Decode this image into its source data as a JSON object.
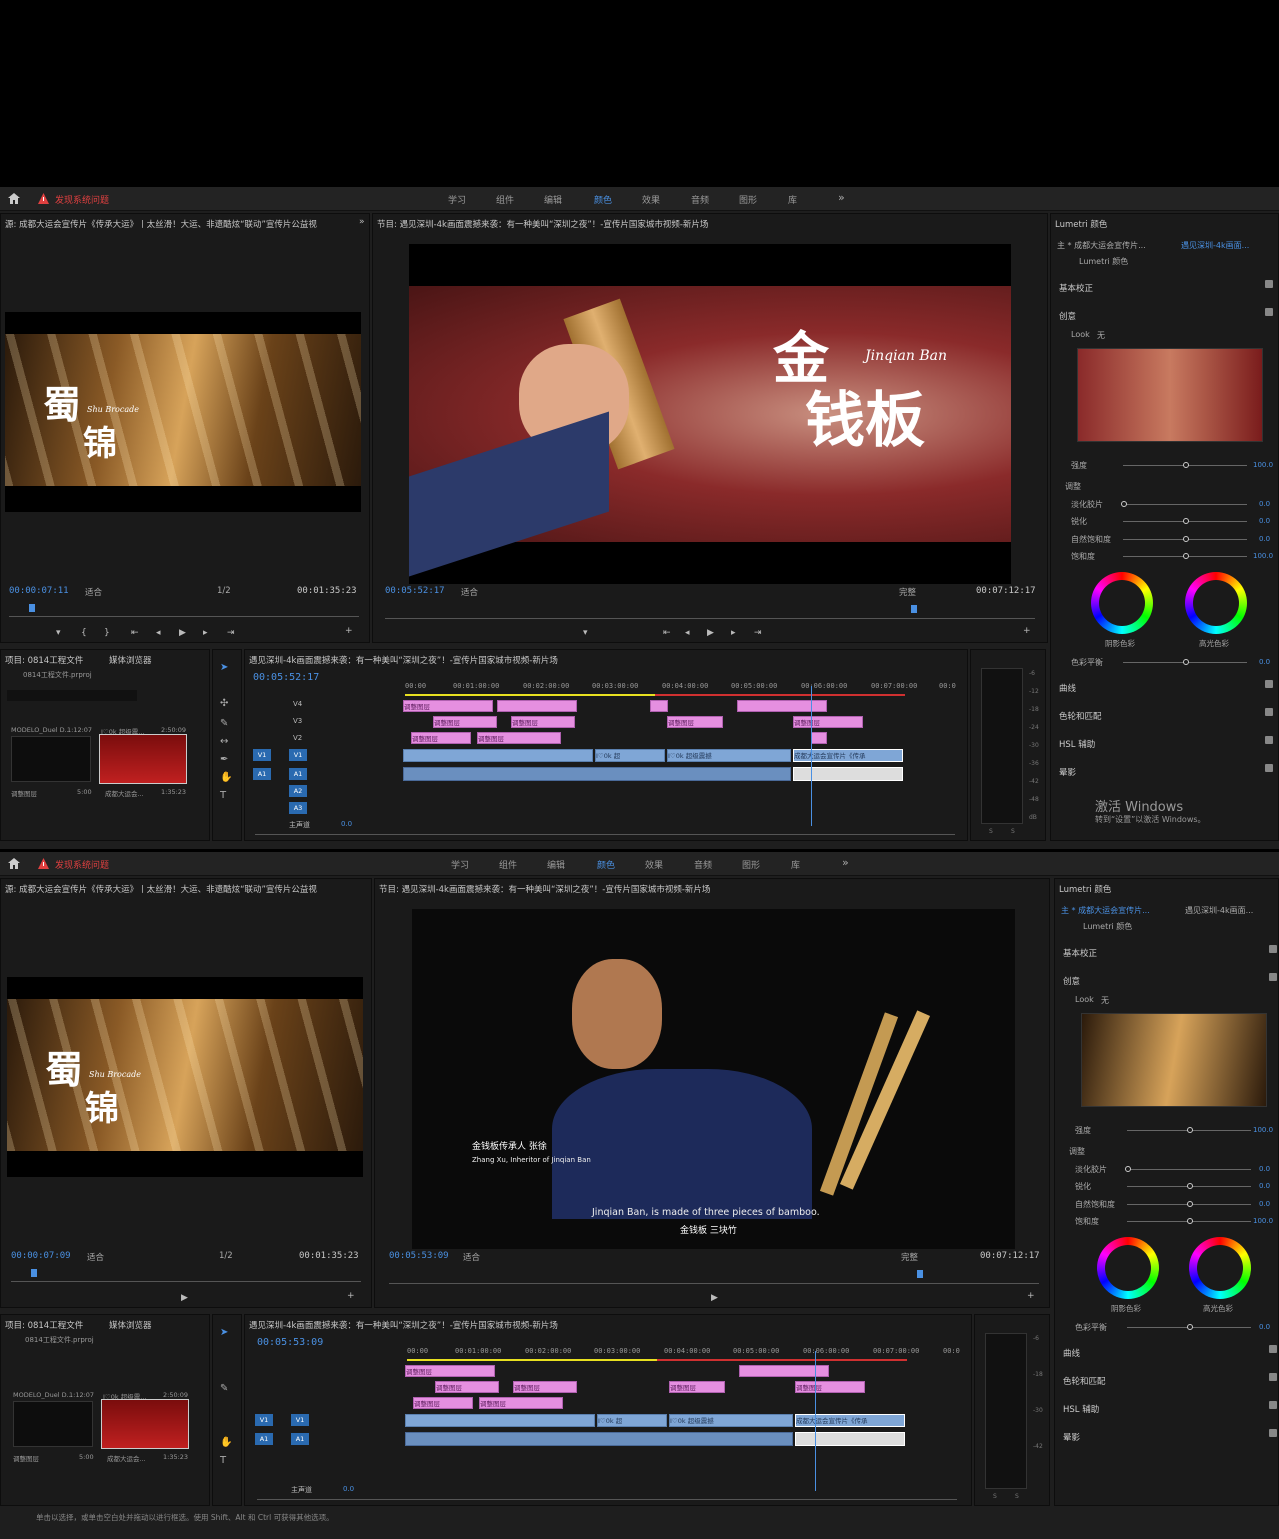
{
  "topbar": {
    "warning": "发现系统问题",
    "tabs": [
      "学习",
      "组件",
      "编辑",
      "颜色",
      "效果",
      "音频",
      "图形",
      "库"
    ],
    "active_tab": "颜色",
    "more": "»"
  },
  "source_panel": {
    "title": "源: 成都大运会宣传片《传承大运》丨太丝滑！大运、非遗酷炫“联动”宣传片公益视",
    "brand_cn_1": "蜀",
    "brand_cn_2": "锦",
    "brand_en": "Shu Brocade",
    "fit": "适合",
    "ratio": "1/2",
    "duration": "00:01:35:23"
  },
  "program_panel": {
    "title": "节目: 遇见深圳-4k画面震撼来袭：有一种美叫“深圳之夜”！-宣传片国家城市视频-新片场",
    "fit": "适合",
    "quality": "完整",
    "duration": "00:07:12:17"
  },
  "screen1": {
    "source_timecode": "00:00:07:11",
    "program_timecode": "00:05:52:17",
    "timeline_timecode": "00:05:52:17",
    "program_brand_cn_1": "金",
    "program_brand_cn_2": "钱板",
    "program_brand_en": "Jinqian Ban"
  },
  "screen2": {
    "source_timecode": "00:00:07:09",
    "program_timecode": "00:05:53:09",
    "timeline_timecode": "00:05:53:09",
    "caption_cn": "金钱板传承人 张徐",
    "caption_en": "Zhang Xu, Inheritor of Jinqian Ban",
    "subtitle_en": "Jinqian Ban, is made of three pieces of bamboo.",
    "subtitle_cn": "金钱板 三块竹"
  },
  "project_panel": {
    "title": "项目: 0814工程文件",
    "media_browser": "媒体浏览器",
    "file": "0814工程文件.prproj",
    "item1_name": "MODELO_Duel D...",
    "item1_dur": "1:12:07",
    "item2_name": "I♡0k 超级震...",
    "item2_dur": "2:50:09",
    "item3_name": "调整图层",
    "item3_dur": "5:00",
    "item4_name": "成都大运会...",
    "item4_dur": "1:35:23"
  },
  "timeline": {
    "title": "遇见深圳-4k画面震撼来袭：有一种美叫“深圳之夜”！-宣传片国家城市视频-新片场",
    "ruler": [
      "00:00",
      "00:01:00:00",
      "00:02:00:00",
      "00:03:00:00",
      "00:04:00:00",
      "00:05:00:00",
      "00:06:00:00",
      "00:07:00:00",
      "00:0"
    ],
    "tracks_video": [
      "V4",
      "V3",
      "V2",
      "V1"
    ],
    "tracks_audio": [
      "A1",
      "A2",
      "A3"
    ],
    "master": "主声道",
    "master_val": "0.0",
    "clip_adjust": "调整图层",
    "clip_v1": "I♡0k 超",
    "clip_v1b": "I♡0k 超级震撼",
    "clip_v1c": "成都大运会宣传片《传承",
    "meter_scale": [
      "-6",
      "-12",
      "-18",
      "-24",
      "-30",
      "-36",
      "-42",
      "-48",
      "-54",
      "dB"
    ],
    "meter_solo": "S"
  },
  "lumetri": {
    "title": "Lumetri 颜色",
    "master_clip": "主 * 成都大运会宣传片...",
    "seq_clip": "遇见深圳-4k画面...",
    "fx": "Lumetri 颜色",
    "basic": "基本校正",
    "creative": "创意",
    "look_label": "Look",
    "look_val": "无",
    "intensity": "强度",
    "intensity_val": "100.0",
    "adjust": "调整",
    "faded_film": "淡化胶片",
    "sharpen": "锐化",
    "vibrance": "自然饱和度",
    "saturation": "饱和度",
    "zero": "0.0",
    "sat_val": "100.0",
    "shadow_tint": "阴影色彩",
    "highlight_tint": "高光色彩",
    "tint_balance": "色彩平衡",
    "curves": "曲线",
    "color_wheels": "色轮和匹配",
    "hsl": "HSL 辅助",
    "vignette": "晕影"
  },
  "activate": {
    "line1": "激活 Windows",
    "line2": "转到“设置”以激活 Windows。"
  },
  "status_bar": "单击以选择，或单击空白处并拖动以进行框选。使用 Shift、Alt 和 Ctrl 可获得其他选项。"
}
